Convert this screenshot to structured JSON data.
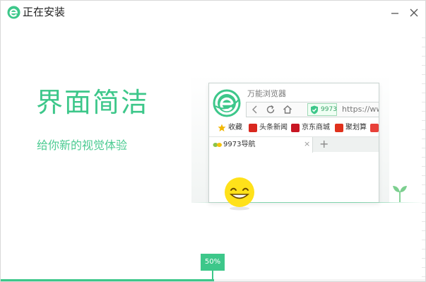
{
  "window": {
    "title": "正在安装"
  },
  "main": {
    "headline": "界面简洁",
    "subline": "给你新的视觉体验"
  },
  "illustration": {
    "browser_name": "万能浏览器",
    "badge_text": "9973",
    "url_text": "https://ww",
    "bookmarks": [
      {
        "label": "收藏",
        "icon": "star-icon",
        "color": "#f2b705"
      },
      {
        "label": "头条新闻",
        "icon": "toutiao-icon",
        "color": "#d9281f"
      },
      {
        "label": "京东商城",
        "icon": "jd-icon",
        "color": "#c81623"
      },
      {
        "label": "聚划算",
        "icon": "juhuasuan-icon",
        "color": "#e0311c"
      },
      {
        "label": "",
        "icon": "partial-bookmark-icon",
        "color": "#e8413a"
      }
    ],
    "tab_label": "9973导航",
    "tab_close": "×",
    "tab_add": "+"
  },
  "progress": {
    "value_percent": 50,
    "label": "50%"
  },
  "colors": {
    "accent": "#3dc78a",
    "title_text": "#222222"
  }
}
